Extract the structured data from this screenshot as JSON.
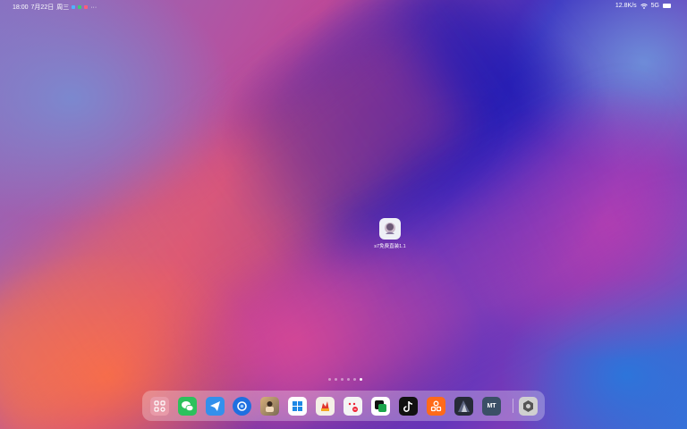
{
  "status_bar": {
    "time": "18:00",
    "date": "7月22日",
    "weekday": "周三",
    "more": "···",
    "net_speed": "12.8K/s",
    "signal": "5G"
  },
  "desktop": {
    "app": {
      "label": "s7免费直装1.1",
      "icon": "app-icon"
    }
  },
  "page_indicator": {
    "count": 6,
    "active": 5
  },
  "dock": {
    "apps": [
      {
        "name": "app-drawer",
        "icon": "grid-icon",
        "color": "#e89aa8"
      },
      {
        "name": "wechat",
        "icon": "wechat-icon",
        "color": "#2dc15c"
      },
      {
        "name": "telegram",
        "icon": "paper-plane-icon",
        "color": "#3390ec"
      },
      {
        "name": "browser",
        "icon": "browser-icon",
        "color": "#1f6fe0"
      },
      {
        "name": "photo-app",
        "icon": "photo-icon",
        "color": "#b88a55"
      },
      {
        "name": "tiles-app",
        "icon": "tiles-icon",
        "color": "#ffffff"
      },
      {
        "name": "game-app",
        "icon": "game-icon",
        "color": "#f4efe6"
      },
      {
        "name": "dice-app",
        "icon": "dice-icon",
        "color": "#f4f4f4"
      },
      {
        "name": "green-app",
        "icon": "green-square-icon",
        "color": "#1aa54a"
      },
      {
        "name": "tiktok",
        "icon": "tiktok-icon",
        "color": "#111111"
      },
      {
        "name": "orange-app",
        "icon": "orange-app-icon",
        "color": "#ff6a1a"
      },
      {
        "name": "dark-game-app",
        "icon": "dark-game-icon",
        "color": "#262b38"
      },
      {
        "name": "mt-manager",
        "icon": "mt-icon",
        "color": "#3b4f66"
      },
      {
        "name": "settings",
        "icon": "hexagon-icon",
        "color": "#d0d0d0"
      }
    ],
    "mt_label": "MT"
  }
}
